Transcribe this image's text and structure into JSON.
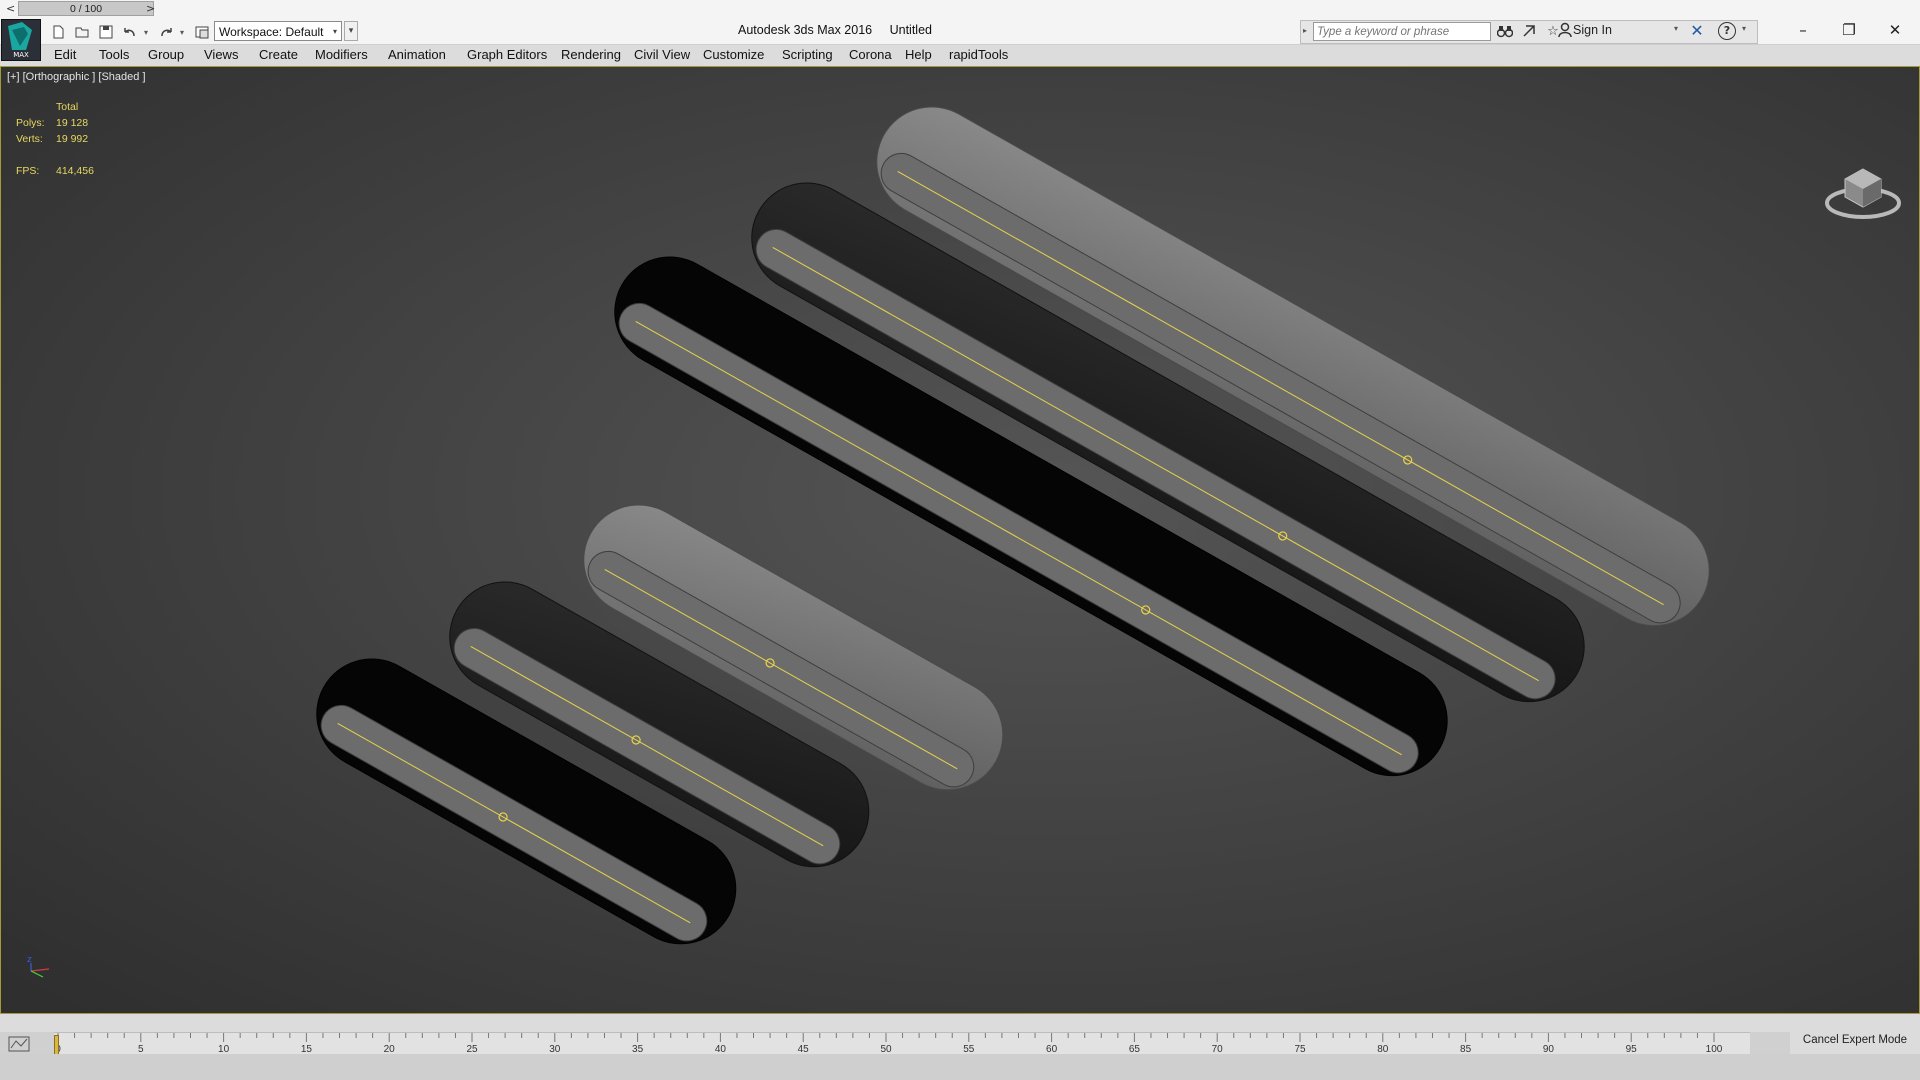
{
  "window": {
    "app_name": "Autodesk 3ds Max 2016",
    "document": "Untitled"
  },
  "app_button": {
    "label": "MAX"
  },
  "quick_access": {
    "icons": [
      "new-file-icon",
      "open-file-icon",
      "save-icon",
      "undo-icon",
      "redo-icon",
      "project-folder-icon"
    ]
  },
  "workspace": {
    "label": "Workspace: Default"
  },
  "search": {
    "placeholder": "Type a keyword or phrase"
  },
  "signin": {
    "label": "Sign In"
  },
  "menu": {
    "items": [
      "Edit",
      "Tools",
      "Group",
      "Views",
      "Create",
      "Modifiers",
      "Animation",
      "Graph Editors",
      "Rendering",
      "Civil View",
      "Customize",
      "Scripting",
      "Corona",
      "Help",
      "rapidTools"
    ]
  },
  "viewport": {
    "label": "[+] [Orthographic ] [Shaded ]",
    "stats": {
      "total_label": "Total",
      "polys_label": "Polys:",
      "polys_value": "19 128",
      "verts_label": "Verts:",
      "verts_value": "19 992",
      "fps_label": "FPS:",
      "fps_value": "414,456"
    },
    "background_color": "#454545",
    "accent_color": "#e8d34a"
  },
  "timeline": {
    "prev": "<",
    "position": "0 / 100",
    "next": ">",
    "ticks": [
      "0",
      "5",
      "10",
      "15",
      "20",
      "25",
      "30",
      "35",
      "40",
      "45",
      "50",
      "55",
      "60",
      "65",
      "70",
      "75",
      "80",
      "85",
      "90",
      "95",
      "100"
    ]
  },
  "status": {
    "cancel_expert_mode": "Cancel Expert Mode"
  }
}
